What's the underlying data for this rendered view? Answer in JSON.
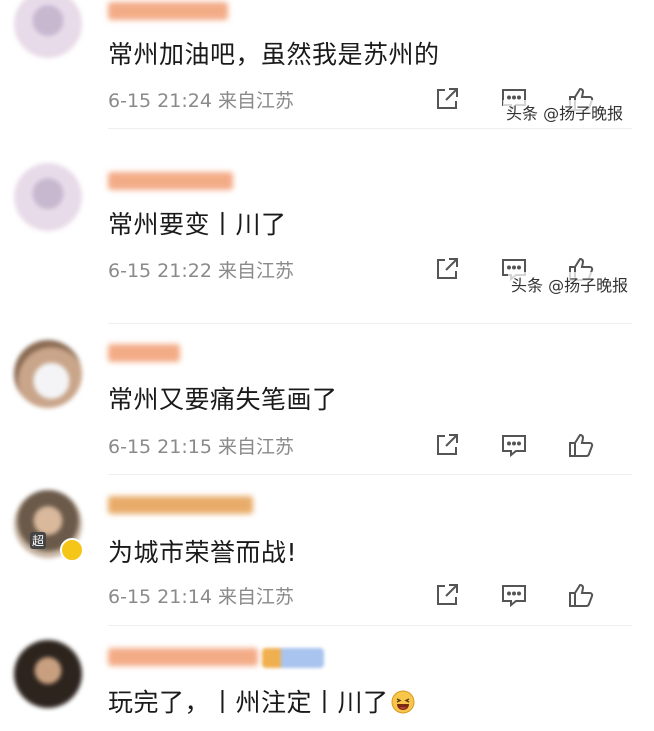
{
  "comments": [
    {
      "text": "常州加油吧，虽然我是苏州的",
      "meta": "6-15 21:24 来自江苏",
      "username_color": "#f0a070"
    },
    {
      "text": "常州要变丨川了",
      "meta": "6-15 21:22 来自江苏",
      "username_color": "#f0a070"
    },
    {
      "text": "常州又要痛失笔画了",
      "meta": "6-15 21:15 来自江苏",
      "username_color": "#f0a070"
    },
    {
      "text": "为城市荣誉而战!",
      "meta": "6-15 21:14 来自江苏",
      "username_color": "#e0a050"
    },
    {
      "text": "玩完了，丨州注定丨川了",
      "meta": "",
      "username_color": "#f0a070"
    }
  ],
  "avatar_badge": "超",
  "watermarks": [
    "头条 @扬子晚报",
    "头条 @扬子晚报"
  ],
  "icons": [
    "share-icon",
    "comment-icon",
    "like-icon"
  ]
}
